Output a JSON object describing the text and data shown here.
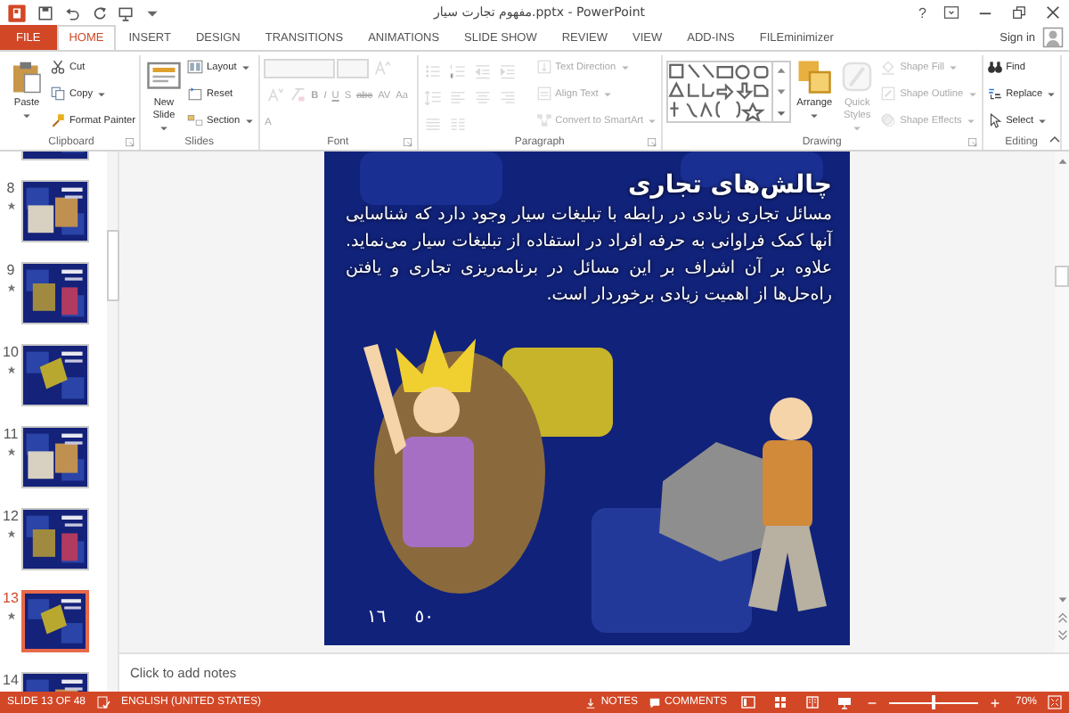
{
  "window": {
    "title": "مفهوم تجارت سیار.pptx - PowerPoint",
    "help": "?"
  },
  "tabs": [
    {
      "label": "FILE",
      "kind": "file",
      "selected": false
    },
    {
      "label": "HOME",
      "kind": "tab",
      "selected": true
    },
    {
      "label": "INSERT",
      "kind": "tab",
      "selected": false
    },
    {
      "label": "DESIGN",
      "kind": "tab",
      "selected": false
    },
    {
      "label": "TRANSITIONS",
      "kind": "tab",
      "selected": false
    },
    {
      "label": "ANIMATIONS",
      "kind": "tab",
      "selected": false
    },
    {
      "label": "SLIDE SHOW",
      "kind": "tab",
      "selected": false
    },
    {
      "label": "REVIEW",
      "kind": "tab",
      "selected": false
    },
    {
      "label": "VIEW",
      "kind": "tab",
      "selected": false
    },
    {
      "label": "ADD-INS",
      "kind": "tab",
      "selected": false
    },
    {
      "label": "FILEminimizer",
      "kind": "tab",
      "selected": false
    }
  ],
  "account": {
    "sign_in": "Sign in"
  },
  "ribbon": {
    "groups": [
      {
        "label": "Clipboard",
        "launcher": true,
        "columns": [
          {
            "kind": "stack",
            "items": [
              {
                "kind": "large",
                "label": "Paste",
                "menu": true,
                "disabled": false
              }
            ]
          },
          {
            "kind": "stack",
            "items": [
              {
                "kind": "small",
                "label": "Cut",
                "menu": false,
                "disabled": false
              },
              {
                "kind": "small",
                "label": "Copy",
                "menu": true,
                "disabled": false
              },
              {
                "kind": "small",
                "label": "Format Painter",
                "menu": false,
                "disabled": false
              }
            ]
          }
        ]
      },
      {
        "label": "Slides",
        "launcher": false,
        "columns": [
          {
            "kind": "stack",
            "items": [
              {
                "kind": "large",
                "label": "New Slide",
                "menu": true,
                "disabled": false
              }
            ]
          },
          {
            "kind": "stack",
            "items": [
              {
                "kind": "small",
                "label": "Layout",
                "menu": true,
                "disabled": false
              },
              {
                "kind": "small",
                "label": "Reset",
                "menu": false,
                "disabled": false
              },
              {
                "kind": "small",
                "label": "Section",
                "menu": true,
                "disabled": false
              }
            ]
          }
        ]
      },
      {
        "label": "Font",
        "launcher": true,
        "columns": [
          {
            "kind": "wrap",
            "items": [
              {
                "kind": "field",
                "disabled": true
              },
              {
                "kind": "field",
                "disabled": true
              },
              {
                "kind": "icon",
                "disabled": true
              },
              {
                "kind": "icon",
                "disabled": true
              },
              {
                "kind": "icon",
                "disabled": true
              },
              {
                "kind": "glyph",
                "label": "B",
                "disabled": true
              },
              {
                "kind": "glyph",
                "label": "I",
                "disabled": true
              },
              {
                "kind": "glyph",
                "label": "U",
                "disabled": true
              },
              {
                "kind": "glyph",
                "label": "S",
                "disabled": true
              },
              {
                "kind": "glyph",
                "label": "abc",
                "disabled": true
              },
              {
                "kind": "glyph",
                "label": "AV",
                "disabled": true
              },
              {
                "kind": "glyph",
                "label": "Aa",
                "disabled": true
              },
              {
                "kind": "glyph",
                "label": "A",
                "disabled": true
              }
            ]
          }
        ]
      },
      {
        "label": "Paragraph",
        "launcher": true,
        "columns": [
          {
            "kind": "wrap",
            "items": [
              {
                "kind": "icon",
                "disabled": true
              },
              {
                "kind": "icon",
                "disabled": true
              },
              {
                "kind": "icon",
                "disabled": true
              },
              {
                "kind": "icon",
                "disabled": true
              },
              {
                "kind": "icon",
                "disabled": true
              },
              {
                "kind": "icon",
                "disabled": true
              },
              {
                "kind": "icon",
                "disabled": true
              },
              {
                "kind": "icon",
                "disabled": true
              },
              {
                "kind": "icon",
                "disabled": true
              },
              {
                "kind": "icon",
                "disabled": true
              }
            ]
          },
          {
            "kind": "stack",
            "items": [
              {
                "kind": "small",
                "label": "Text Direction",
                "menu": true,
                "disabled": true
              },
              {
                "kind": "small",
                "label": "Align Text",
                "menu": true,
                "disabled": true
              },
              {
                "kind": "small",
                "label": "Convert to SmartArt",
                "menu": true,
                "disabled": true
              }
            ]
          }
        ]
      },
      {
        "label": "Drawing",
        "launcher": true,
        "columns": [
          {
            "kind": "stack",
            "items": [
              {
                "kind": "gallery",
                "disabled": false
              }
            ]
          },
          {
            "kind": "stack",
            "items": [
              {
                "kind": "large",
                "label": "Arrange",
                "menu": true,
                "disabled": false
              }
            ]
          },
          {
            "kind": "stack",
            "items": [
              {
                "kind": "large",
                "label": "Quick Styles",
                "menu": true,
                "disabled": true
              }
            ]
          },
          {
            "kind": "stack",
            "items": [
              {
                "kind": "small",
                "label": "Shape Fill",
                "menu": true,
                "disabled": true
              },
              {
                "kind": "small",
                "label": "Shape Outline",
                "menu": true,
                "disabled": true
              },
              {
                "kind": "small",
                "label": "Shape Effects",
                "menu": true,
                "disabled": true
              }
            ]
          }
        ]
      },
      {
        "label": "Editing",
        "launcher": false,
        "columns": [
          {
            "kind": "stack",
            "items": [
              {
                "kind": "small",
                "label": "Find",
                "menu": false,
                "disabled": false
              },
              {
                "kind": "small",
                "label": "Replace",
                "menu": true,
                "disabled": false
              },
              {
                "kind": "small",
                "label": "Select",
                "menu": true,
                "disabled": false
              }
            ]
          }
        ]
      }
    ]
  },
  "thumbnails": [
    {
      "kind": "partial",
      "animated": false,
      "selected": false
    },
    {
      "kind": "full",
      "number": "8",
      "animated": true,
      "selected": false
    },
    {
      "kind": "full",
      "number": "9",
      "animated": true,
      "selected": false
    },
    {
      "kind": "full",
      "number": "10",
      "animated": true,
      "selected": false
    },
    {
      "kind": "full",
      "number": "11",
      "animated": true,
      "selected": false
    },
    {
      "kind": "full",
      "number": "12",
      "animated": true,
      "selected": false
    },
    {
      "kind": "full",
      "number": "13",
      "animated": true,
      "selected": true
    },
    {
      "kind": "full",
      "number": "14",
      "animated": false,
      "selected": false
    }
  ],
  "slide": {
    "title": "چالش‌های تجاری",
    "body": "مسائل تجاری زیادی در رابطه با تبلیغات سیار وجود دارد که شناسایی آنها کمک فراوانی به حرفه افراد در استفاده از تبلیغات سیار می‌نماید. علاوه بر آن اشراف بر این مسائل در برنامه‌ریزی تجاری و یافتن راه‌حل‌ها از اهمیت زیادی برخوردار است.",
    "footer": [
      "٥٠",
      "١٦"
    ]
  },
  "notes": {
    "placeholder": "Click to add notes"
  },
  "status_bar": {
    "slide": "SLIDE 13 OF 48",
    "language": "ENGLISH (UNITED STATES)",
    "notes": "NOTES",
    "comments": "COMMENTS",
    "zoom": "70%",
    "zoom_slider": {
      "level": 0.5
    }
  }
}
